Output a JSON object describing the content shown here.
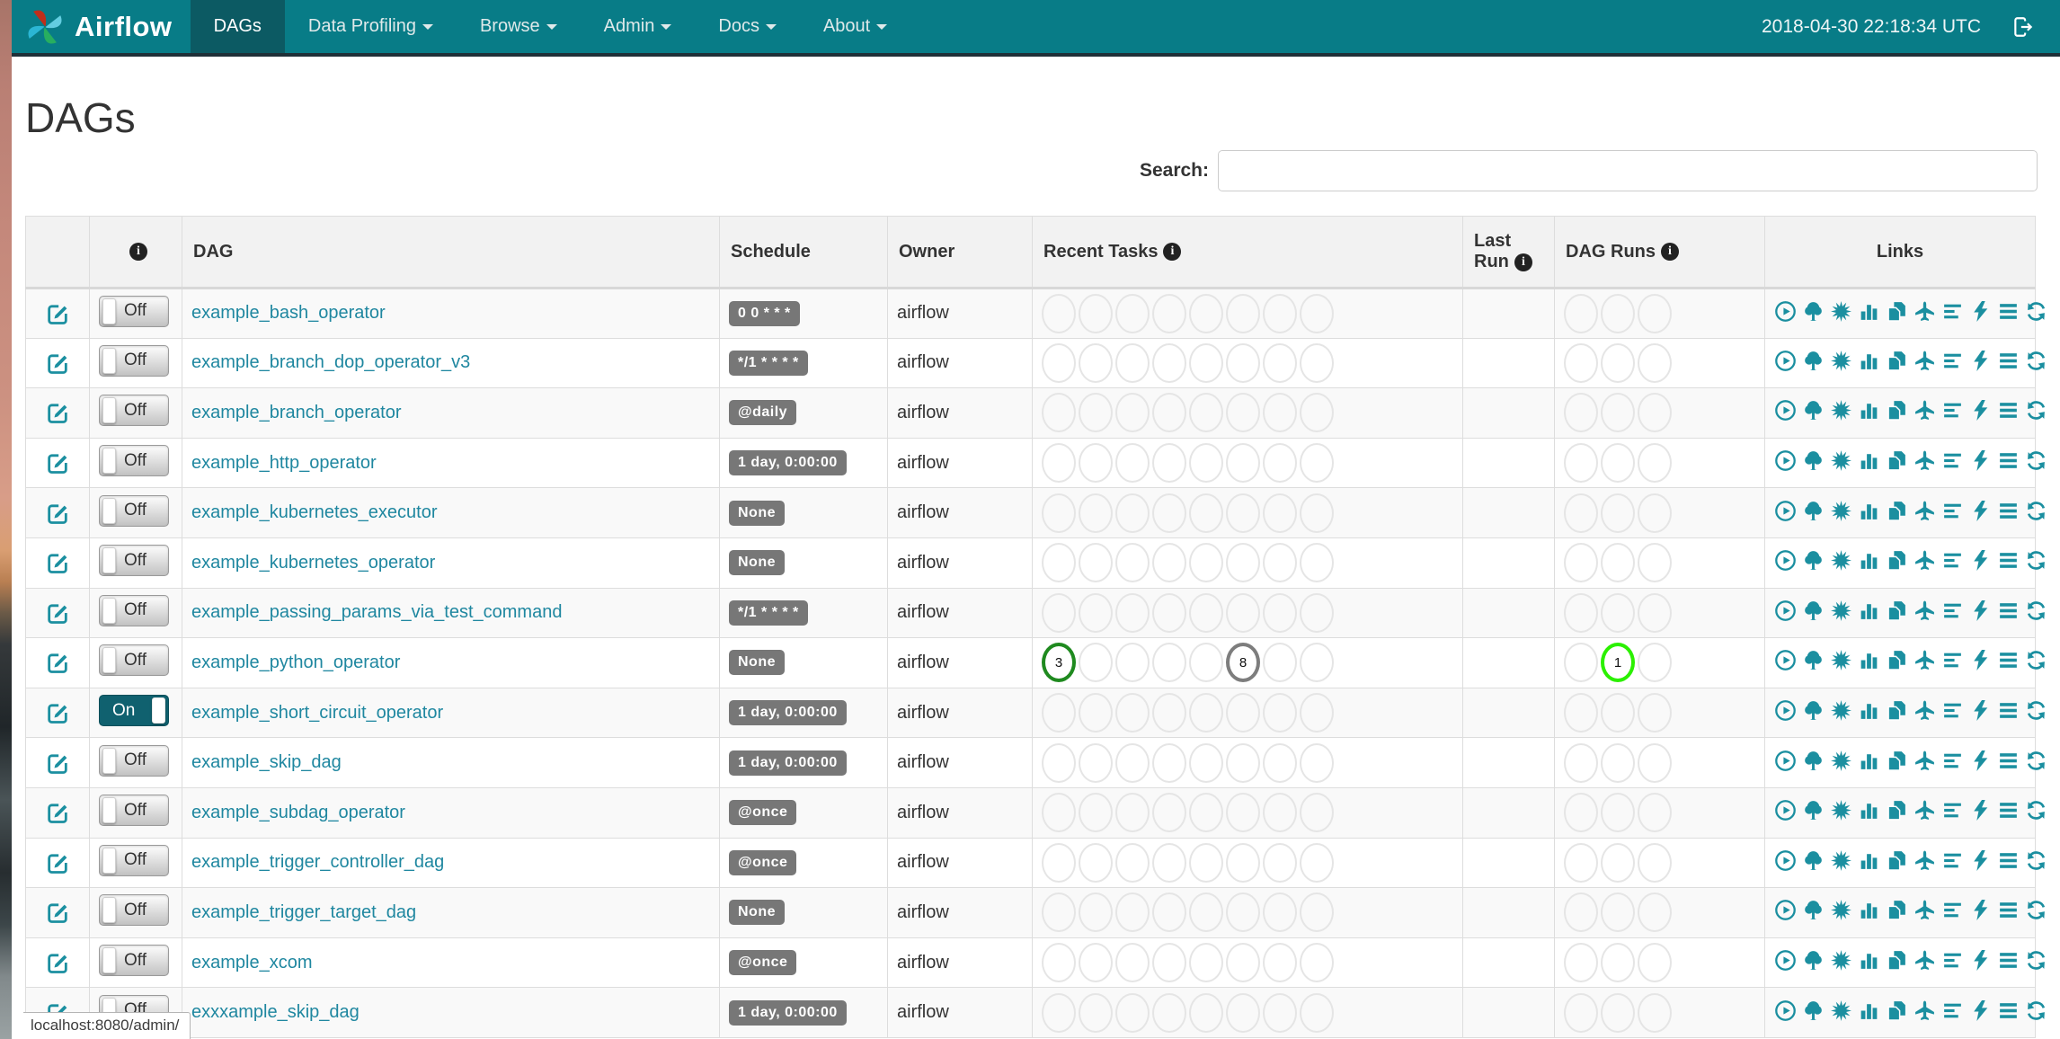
{
  "colors": {
    "navbar": "#087c87",
    "navbar_active": "#0c5a63",
    "toggle_on": "#10616f",
    "link": "#1f87a0",
    "icon": "#1b8fa0",
    "badge": "#777777",
    "success": "#1f8a1f",
    "running": "#2bf000",
    "no_status": "#7d7d7d"
  },
  "navbar": {
    "brand": "Airflow",
    "items": [
      {
        "label": "DAGs",
        "active": true,
        "caret": false
      },
      {
        "label": "Data Profiling",
        "active": false,
        "caret": true
      },
      {
        "label": "Browse",
        "active": false,
        "caret": true
      },
      {
        "label": "Admin",
        "active": false,
        "caret": true
      },
      {
        "label": "Docs",
        "active": false,
        "caret": true
      },
      {
        "label": "About",
        "active": false,
        "caret": true
      }
    ],
    "clock": "2018-04-30 22:18:34 UTC"
  },
  "page": {
    "title": "DAGs"
  },
  "search": {
    "label": "Search:",
    "value": ""
  },
  "table": {
    "headers": {
      "dag": "DAG",
      "schedule": "Schedule",
      "owner": "Owner",
      "recent_tasks": "Recent Tasks",
      "last_run": "Last Run",
      "dag_runs": "DAG Runs",
      "links": "Links"
    },
    "recent_task_slots": 8,
    "dag_run_slots": 3,
    "links_icons": [
      "trigger-dag",
      "tree-view",
      "graph-view",
      "task-duration",
      "task-tries",
      "landing-times",
      "gantt",
      "code-view",
      "logs",
      "refresh"
    ],
    "rows": [
      {
        "toggle": "Off",
        "dag": "example_bash_operator",
        "schedule": "0 0 * * *",
        "owner": "airflow",
        "recent_tasks": [],
        "last_run": "",
        "dag_runs": []
      },
      {
        "toggle": "Off",
        "dag": "example_branch_dop_operator_v3",
        "schedule": "*/1 * * * *",
        "owner": "airflow",
        "recent_tasks": [],
        "last_run": "",
        "dag_runs": []
      },
      {
        "toggle": "Off",
        "dag": "example_branch_operator",
        "schedule": "@daily",
        "owner": "airflow",
        "recent_tasks": [],
        "last_run": "",
        "dag_runs": []
      },
      {
        "toggle": "Off",
        "dag": "example_http_operator",
        "schedule": "1 day, 0:00:00",
        "owner": "airflow",
        "recent_tasks": [],
        "last_run": "",
        "dag_runs": []
      },
      {
        "toggle": "Off",
        "dag": "example_kubernetes_executor",
        "schedule": "None",
        "owner": "airflow",
        "recent_tasks": [],
        "last_run": "",
        "dag_runs": []
      },
      {
        "toggle": "Off",
        "dag": "example_kubernetes_operator",
        "schedule": "None",
        "owner": "airflow",
        "recent_tasks": [],
        "last_run": "",
        "dag_runs": []
      },
      {
        "toggle": "Off",
        "dag": "example_passing_params_via_test_command",
        "schedule": "*/1 * * * *",
        "owner": "airflow",
        "recent_tasks": [],
        "last_run": "",
        "dag_runs": []
      },
      {
        "toggle": "Off",
        "dag": "example_python_operator",
        "schedule": "None",
        "owner": "airflow",
        "recent_tasks": [
          {
            "slot": 1,
            "count": 3,
            "state": "success"
          },
          {
            "slot": 6,
            "count": 8,
            "state": "no_status"
          }
        ],
        "last_run": "",
        "dag_runs": [
          {
            "slot": 2,
            "count": 1,
            "state": "running"
          }
        ]
      },
      {
        "toggle": "On",
        "dag": "example_short_circuit_operator",
        "schedule": "1 day, 0:00:00",
        "owner": "airflow",
        "recent_tasks": [],
        "last_run": "",
        "dag_runs": []
      },
      {
        "toggle": "Off",
        "dag": "example_skip_dag",
        "schedule": "1 day, 0:00:00",
        "owner": "airflow",
        "recent_tasks": [],
        "last_run": "",
        "dag_runs": []
      },
      {
        "toggle": "Off",
        "dag": "example_subdag_operator",
        "schedule": "@once",
        "owner": "airflow",
        "recent_tasks": [],
        "last_run": "",
        "dag_runs": []
      },
      {
        "toggle": "Off",
        "dag": "example_trigger_controller_dag",
        "schedule": "@once",
        "owner": "airflow",
        "recent_tasks": [],
        "last_run": "",
        "dag_runs": []
      },
      {
        "toggle": "Off",
        "dag": "example_trigger_target_dag",
        "schedule": "None",
        "owner": "airflow",
        "recent_tasks": [],
        "last_run": "",
        "dag_runs": []
      },
      {
        "toggle": "Off",
        "dag": "example_xcom",
        "schedule": "@once",
        "owner": "airflow",
        "recent_tasks": [],
        "last_run": "",
        "dag_runs": []
      },
      {
        "toggle": "Off",
        "dag": "exxxample_skip_dag",
        "schedule": "1 day, 0:00:00",
        "owner": "airflow",
        "recent_tasks": [],
        "last_run": "",
        "dag_runs": []
      }
    ]
  },
  "status_bar": {
    "text": "localhost:8080/admin/"
  }
}
